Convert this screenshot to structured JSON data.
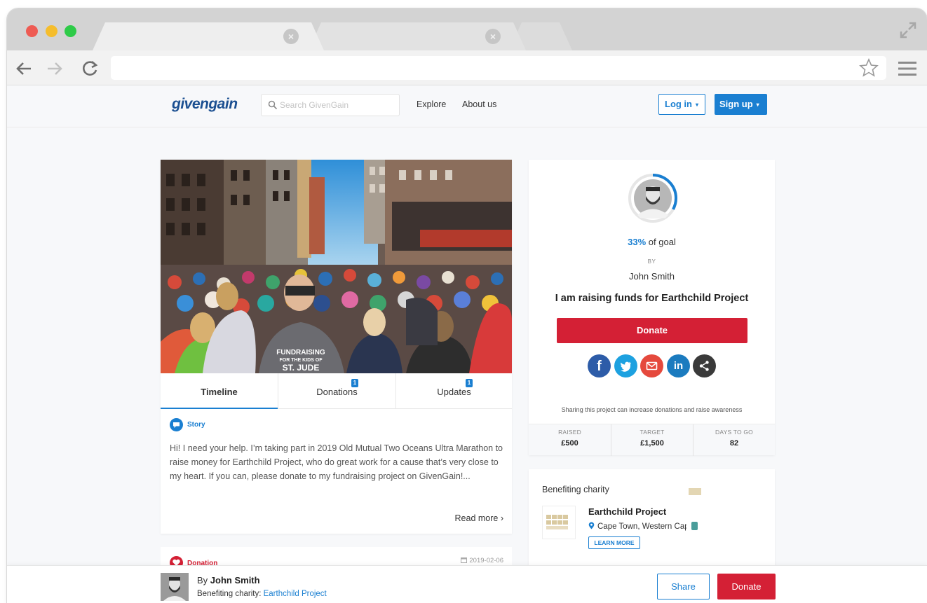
{
  "browser": {
    "tab_close_glyph": "×"
  },
  "site": {
    "logo": "givengain",
    "search_placeholder": "Search GivenGain",
    "nav": {
      "explore": "Explore",
      "about": "About us"
    },
    "login_label": "Log in",
    "signup_label": "Sign up",
    "caret": "▾"
  },
  "hero": {
    "shirt_line1": "FUNDRAISING",
    "shirt_line2": "FOR THE KIDS OF",
    "shirt_line3": "ST. JUDE"
  },
  "tabs": [
    {
      "label": "Timeline",
      "badge": ""
    },
    {
      "label": "Donations",
      "badge": "1"
    },
    {
      "label": "Updates",
      "badge": "1"
    }
  ],
  "story": {
    "label": "Story",
    "text": "Hi! I need your help. I’m taking part in 2019 Old Mutual Two Oceans Ultra Marathon to raise money for Earthchild Project, who do great work for a cause that’s very close to my heart. If you can, please donate to my fundraising project on GivenGain!...",
    "read_more": "Read more ›"
  },
  "donation_entry": {
    "label": "Donation",
    "date": "2019-02-06"
  },
  "project": {
    "goal_percent": "33%",
    "goal_progress": 0.33,
    "goal_suffix": " of goal",
    "by_label": "BY",
    "owner": "John Smith",
    "headline": "I am raising funds for Earthchild Project",
    "donate_label": "Donate",
    "social": {
      "facebook": "f",
      "linkedin": "in"
    },
    "share_note": "Sharing this project can increase donations and raise awareness",
    "stats": [
      {
        "label": "RAISED",
        "value": "£500"
      },
      {
        "label": "TARGET",
        "value": "£1,500"
      },
      {
        "label": "DAYS TO GO",
        "value": "82"
      }
    ]
  },
  "charity": {
    "section_title": "Benefiting charity",
    "name": "Earthchild Project",
    "location": "Cape Town, Western Cape",
    "learn_more": "LEARN MORE"
  },
  "bottom_bar": {
    "by_prefix": "By ",
    "owner": "John Smith",
    "charity_prefix": "Benefiting charity: ",
    "charity_name": "Earthchild Project",
    "share_label": "Share",
    "donate_label": "Donate"
  },
  "colors": {
    "brand_blue": "#1a7fd1",
    "donate_red": "#d42035",
    "logo_navy": "#1b4f91"
  }
}
